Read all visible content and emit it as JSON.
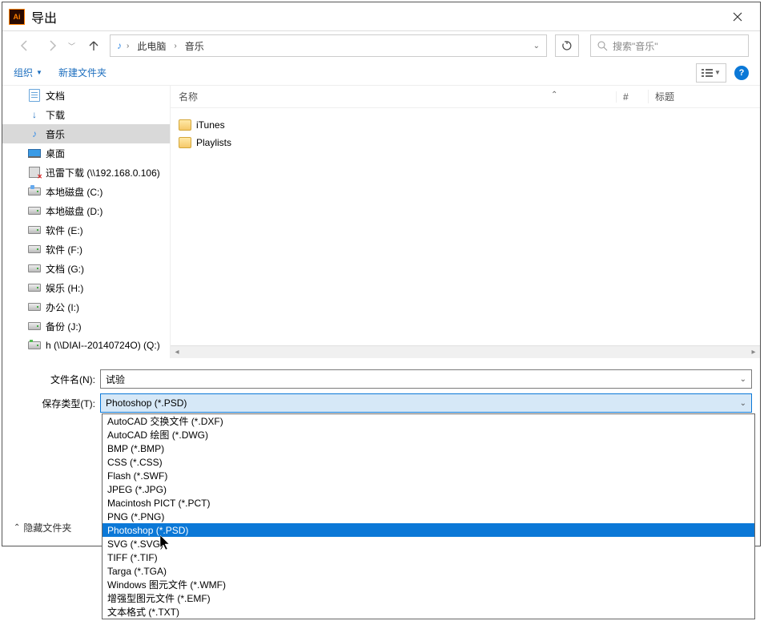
{
  "title": "导出",
  "ai_icon_text": "Ai",
  "path": {
    "root": "此电脑",
    "current": "音乐"
  },
  "search_placeholder": "搜索\"音乐\"",
  "toolbar": {
    "organize": "组织",
    "new_folder": "新建文件夹"
  },
  "columns": {
    "name": "名称",
    "num": "#",
    "title": "标题"
  },
  "sidebar": [
    {
      "label": "文档",
      "icon": "doc"
    },
    {
      "label": "下载",
      "icon": "download"
    },
    {
      "label": "音乐",
      "icon": "music",
      "selected": true
    },
    {
      "label": "桌面",
      "icon": "desktop"
    },
    {
      "label": "迅雷下载 (\\\\192.168.0.106)",
      "icon": "net"
    },
    {
      "label": "本地磁盘 (C:)",
      "icon": "drive-win"
    },
    {
      "label": "本地磁盘 (D:)",
      "icon": "drive"
    },
    {
      "label": "软件 (E:)",
      "icon": "drive"
    },
    {
      "label": "软件 (F:)",
      "icon": "drive"
    },
    {
      "label": "文档 (G:)",
      "icon": "drive"
    },
    {
      "label": "娱乐 (H:)",
      "icon": "drive"
    },
    {
      "label": "办公 (I:)",
      "icon": "drive"
    },
    {
      "label": "备份 (J:)",
      "icon": "drive"
    },
    {
      "label": "h (\\\\DIAI--20140724O) (Q:)",
      "icon": "netdrv"
    }
  ],
  "files": [
    {
      "name": "iTunes"
    },
    {
      "name": "Playlists"
    }
  ],
  "labels": {
    "filename": "文件名(N):",
    "filetype": "保存类型(T):",
    "hide_folders": "隐藏文件夹"
  },
  "filename_value": "试验",
  "filetype_value": "Photoshop (*.PSD)",
  "filetype_options": [
    "AutoCAD 交换文件 (*.DXF)",
    "AutoCAD 绘图 (*.DWG)",
    "BMP (*.BMP)",
    "CSS (*.CSS)",
    "Flash (*.SWF)",
    "JPEG (*.JPG)",
    "Macintosh PICT (*.PCT)",
    "PNG (*.PNG)",
    "Photoshop (*.PSD)",
    "SVG (*.SVG)",
    "TIFF (*.TIF)",
    "Targa (*.TGA)",
    "Windows 图元文件 (*.WMF)",
    "增强型图元文件 (*.EMF)",
    "文本格式 (*.TXT)"
  ],
  "filetype_hover_index": 8
}
